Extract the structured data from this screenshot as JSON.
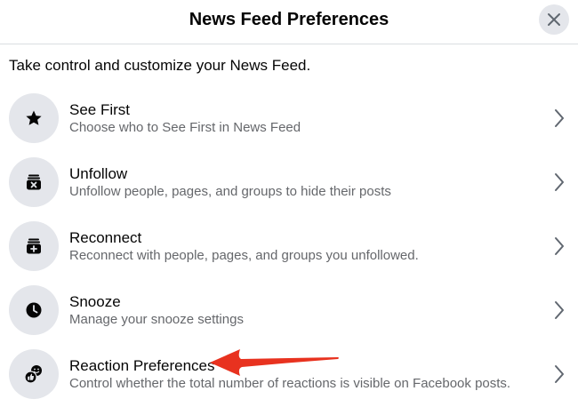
{
  "header": {
    "title": "News Feed Preferences",
    "close_icon": "close-icon"
  },
  "subtitle": "Take control and customize your News Feed.",
  "items": [
    {
      "icon": "star-icon",
      "title": "See First",
      "description": "Choose who to See First in News Feed"
    },
    {
      "icon": "unfollow-inbox-icon",
      "title": "Unfollow",
      "description": "Unfollow people, pages, and groups to hide their posts"
    },
    {
      "icon": "reconnect-inbox-icon",
      "title": "Reconnect",
      "description": "Reconnect with people, pages, and groups you unfollowed."
    },
    {
      "icon": "clock-icon",
      "title": "Snooze",
      "description": "Manage your snooze settings"
    },
    {
      "icon": "reactions-icon",
      "title": "Reaction Preferences",
      "description": "Control whether the total number of reactions is visible on Facebook posts."
    }
  ],
  "colors": {
    "icon_bg": "#e4e6eb",
    "annotation_arrow": "#e8321f"
  }
}
